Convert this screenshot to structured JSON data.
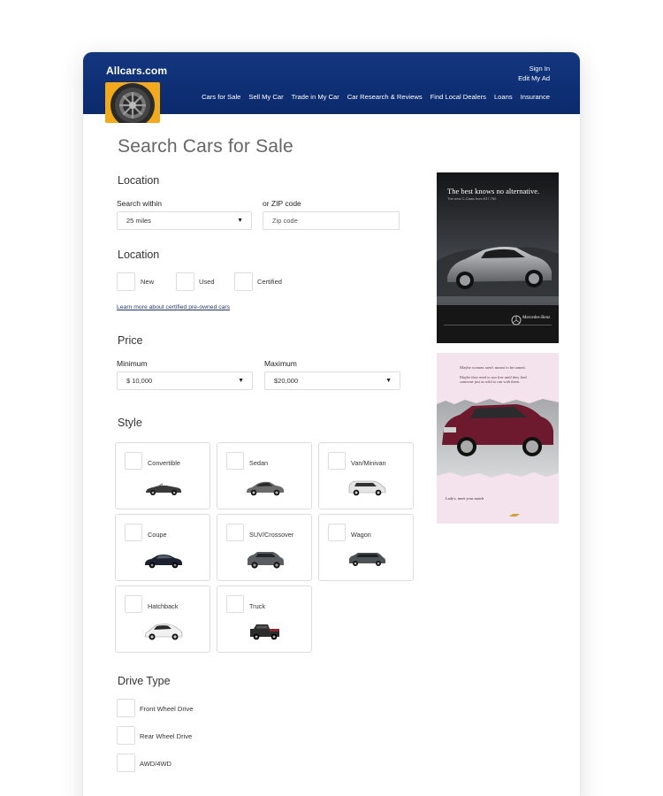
{
  "header": {
    "logo": "Allcars.com",
    "account": {
      "sign_in": "Sign In",
      "edit_ad": "Edit My Ad"
    },
    "nav": [
      "Cars for Sale",
      "Sell My Car",
      "Trade in My Car",
      "Car Research & Reviews",
      "Find Local Dealers",
      "Loans",
      "Insurance"
    ]
  },
  "page": {
    "title": "Search Cars for Sale"
  },
  "location": {
    "title": "Location",
    "search_within_label": "Search within",
    "search_within_value": "25 miles",
    "zip_label": "or ZIP code",
    "zip_placeholder": "Zip code"
  },
  "condition": {
    "title": "Location",
    "options": [
      "New",
      "Used",
      "Certified"
    ],
    "learn_more": "Learn more about certified pre-owned cars"
  },
  "price": {
    "title": "Price",
    "min_label": "Minimum",
    "min_value": "$ 10,000",
    "max_label": "Maximum",
    "max_value": "$20,000"
  },
  "style": {
    "title": "Style",
    "options": [
      "Convertible",
      "Sedan",
      "Van/Minivan",
      "Coupe",
      "SUV/Crossover",
      "Wagon",
      "Hatchback",
      "Truck"
    ]
  },
  "drive": {
    "title": "Drive Type",
    "options": [
      "Front Wheel Drive",
      "Rear Wheel Drive",
      "AWD/4WD"
    ]
  },
  "ads": {
    "mercedes": {
      "headline": "The best knows no alternative.",
      "sub": "The new C-Class from €37,750",
      "brand": "Mercedes-Benz"
    },
    "chevrolet": {
      "headline": "Maybe women aren't meant to be tamed.",
      "body": "Maybe they need to run free until they find someone just as wild to run with them.",
      "caption": "Lady's, meet your match"
    }
  },
  "colors": {
    "header": "#12367f",
    "logo_badge": "#f2a91c",
    "link": "#233a72"
  }
}
